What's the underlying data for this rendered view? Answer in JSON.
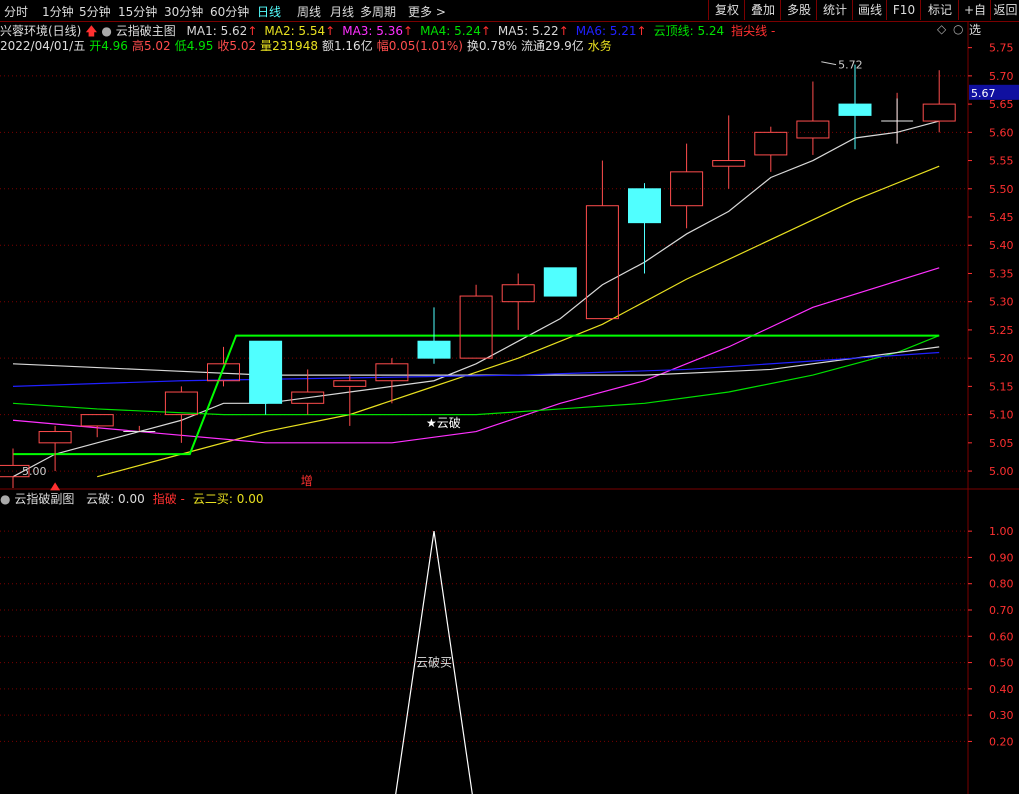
{
  "colors": {
    "up": "#ff4d4d",
    "down": "#50ffff",
    "ma1": "#d8d8d8",
    "ma2": "#e8e020",
    "ma3": "#ff30ff",
    "ma4": "#00e000",
    "ma5": "#d8d8d8",
    "ma6": "#2020ff",
    "cloud": "#00ff00",
    "grid": "#7a0000",
    "axis": "#ff3030"
  },
  "toolbar": {
    "periods": [
      "分时",
      "1分钟",
      "5分钟",
      "15分钟",
      "30分钟",
      "60分钟",
      "日线",
      "周线",
      "月线",
      "多周期",
      "更多 >"
    ],
    "active_index": 6,
    "buttons": [
      "复权",
      "叠加",
      "多股",
      "统计",
      "画线",
      "F10",
      "标记",
      "+自选",
      "返回"
    ]
  },
  "header": {
    "stock": "兴蓉环境(日线)",
    "indicator": "云指破主图",
    "ma": [
      {
        "label": "MA1: 5.62",
        "color": "#d8d8d8",
        "arrow": "↑"
      },
      {
        "label": "MA2: 5.54",
        "color": "#e8e020",
        "arrow": "↑"
      },
      {
        "label": "MA3: 5.36",
        "color": "#ff30ff",
        "arrow": "↑"
      },
      {
        "label": "MA4: 5.24",
        "color": "#00e000",
        "arrow": "↑"
      },
      {
        "label": "MA5: 5.22",
        "color": "#d8d8d8",
        "arrow": "↑"
      },
      {
        "label": "MA6: 5.21",
        "color": "#2020ff",
        "arrow": "↑"
      },
      {
        "label": "云顶线: 5.24",
        "color": "#00e000",
        "arrow": ""
      },
      {
        "label": "指尖线 -",
        "color": "#ff3030",
        "arrow": ""
      }
    ],
    "info": [
      {
        "label": "2022/04/01/五",
        "color": "#ddd"
      },
      {
        "label": "开4.96",
        "color": "#00e000"
      },
      {
        "label": "高5.02",
        "color": "#ff4d4d"
      },
      {
        "label": "低4.95",
        "color": "#00e000"
      },
      {
        "label": "收5.02",
        "color": "#ff4d4d"
      },
      {
        "label": "量231948",
        "color": "#e8e020"
      },
      {
        "label": "额1.16亿",
        "color": "#ddd"
      },
      {
        "label": "幅0.05(1.01%)",
        "color": "#ff4d4d"
      },
      {
        "label": "换0.78%",
        "color": "#ddd"
      },
      {
        "label": "流通29.9亿",
        "color": "#ddd"
      },
      {
        "label": "水务",
        "color": "#e8e020"
      }
    ]
  },
  "sub_header": {
    "name": "云指破副图",
    "items": [
      {
        "label": "云破: 0.00",
        "color": "#ddd"
      },
      {
        "label": "指破 -",
        "color": "#ff3030"
      },
      {
        "label": "云二买: 0.00",
        "color": "#e8e020"
      }
    ]
  },
  "annotations": {
    "max": "5.72",
    "min": "5.00",
    "cloud_break": "★云破",
    "zeng": "增",
    "sub_label": "云破买",
    "current_price": "5.67"
  },
  "chart_data": [
    {
      "type": "candlestick",
      "title": "云指破主图",
      "ylim": [
        4.97,
        5.76
      ],
      "yticks": [
        5.0,
        5.05,
        5.1,
        5.15,
        5.2,
        5.25,
        5.3,
        5.35,
        5.4,
        5.45,
        5.5,
        5.55,
        5.6,
        5.65,
        5.7,
        5.75
      ],
      "candles": [
        {
          "o": 4.99,
          "h": 5.04,
          "l": 4.97,
          "c": 5.01
        },
        {
          "o": 5.05,
          "h": 5.08,
          "l": 5.0,
          "c": 5.07
        },
        {
          "o": 5.08,
          "h": 5.1,
          "l": 5.06,
          "c": 5.1
        },
        {
          "o": 5.07,
          "h": 5.08,
          "l": 5.07,
          "c": 5.07
        },
        {
          "o": 5.1,
          "h": 5.15,
          "l": 5.05,
          "c": 5.14
        },
        {
          "o": 5.16,
          "h": 5.22,
          "l": 5.15,
          "c": 5.19
        },
        {
          "o": 5.23,
          "h": 5.23,
          "l": 5.1,
          "c": 5.12
        },
        {
          "o": 5.12,
          "h": 5.18,
          "l": 5.1,
          "c": 5.14
        },
        {
          "o": 5.15,
          "h": 5.17,
          "l": 5.08,
          "c": 5.16
        },
        {
          "o": 5.16,
          "h": 5.2,
          "l": 5.12,
          "c": 5.19
        },
        {
          "o": 5.23,
          "h": 5.29,
          "l": 5.19,
          "c": 5.2
        },
        {
          "o": 5.2,
          "h": 5.33,
          "l": 5.2,
          "c": 5.31
        },
        {
          "o": 5.3,
          "h": 5.35,
          "l": 5.25,
          "c": 5.33
        },
        {
          "o": 5.36,
          "h": 5.36,
          "l": 5.31,
          "c": 5.31
        },
        {
          "o": 5.27,
          "h": 5.55,
          "l": 5.27,
          "c": 5.47
        },
        {
          "o": 5.5,
          "h": 5.51,
          "l": 5.35,
          "c": 5.44
        },
        {
          "o": 5.47,
          "h": 5.58,
          "l": 5.43,
          "c": 5.53
        },
        {
          "o": 5.54,
          "h": 5.63,
          "l": 5.5,
          "c": 5.55
        },
        {
          "o": 5.56,
          "h": 5.61,
          "l": 5.53,
          "c": 5.6
        },
        {
          "o": 5.59,
          "h": 5.69,
          "l": 5.56,
          "c": 5.62
        },
        {
          "o": 5.65,
          "h": 5.72,
          "l": 5.57,
          "c": 5.63
        },
        {
          "o": 5.62,
          "h": 5.67,
          "l": 5.58,
          "c": 5.62
        },
        {
          "o": 5.62,
          "h": 5.71,
          "l": 5.6,
          "c": 5.65
        }
      ],
      "series": [
        {
          "name": "MA1",
          "color": "#d8d8d8",
          "x": [
            0,
            1,
            2,
            3,
            4,
            5,
            6,
            7,
            8,
            9,
            10,
            11,
            12,
            13,
            14,
            15,
            16,
            17,
            18,
            19,
            20,
            21,
            22
          ],
          "values": [
            4.99,
            5.03,
            5.05,
            5.07,
            5.09,
            5.12,
            5.12,
            5.13,
            5.14,
            5.15,
            5.16,
            5.19,
            5.23,
            5.27,
            5.33,
            5.37,
            5.42,
            5.46,
            5.52,
            5.55,
            5.59,
            5.6,
            5.62
          ]
        },
        {
          "name": "MA2",
          "color": "#e8e020",
          "x": [
            2,
            4,
            6,
            8,
            10,
            12,
            14,
            16,
            18,
            20,
            22
          ],
          "values": [
            4.99,
            5.03,
            5.07,
            5.1,
            5.15,
            5.2,
            5.26,
            5.34,
            5.41,
            5.48,
            5.54
          ]
        },
        {
          "name": "MA3",
          "color": "#ff30ff",
          "x": [
            0,
            3,
            6,
            9,
            11,
            13,
            15,
            17,
            19,
            22
          ],
          "values": [
            5.09,
            5.07,
            5.05,
            5.05,
            5.07,
            5.12,
            5.16,
            5.22,
            5.29,
            5.36
          ]
        },
        {
          "name": "MA4",
          "color": "#00e000",
          "x": [
            0,
            2,
            5,
            8,
            11,
            13,
            15,
            17,
            19,
            21,
            22
          ],
          "values": [
            5.12,
            5.11,
            5.1,
            5.1,
            5.1,
            5.11,
            5.12,
            5.14,
            5.17,
            5.21,
            5.24
          ]
        },
        {
          "name": "MA5",
          "color": "#d8d8d8",
          "x": [
            0,
            3,
            6,
            9,
            12,
            15,
            18,
            20,
            22
          ],
          "values": [
            5.19,
            5.18,
            5.17,
            5.17,
            5.17,
            5.17,
            5.18,
            5.2,
            5.22
          ]
        },
        {
          "name": "MA6",
          "color": "#2020ff",
          "x": [
            0,
            4,
            8,
            12,
            16,
            19,
            22
          ],
          "values": [
            5.15,
            5.16,
            5.165,
            5.17,
            5.18,
            5.195,
            5.21
          ]
        },
        {
          "name": "云顶线",
          "color": "#00ff00",
          "x": [
            0,
            4.2,
            5.3,
            22
          ],
          "values": [
            5.03,
            5.03,
            5.24,
            5.24
          ]
        }
      ]
    },
    {
      "type": "line",
      "title": "云指破副图",
      "ylim": [
        0,
        1.05
      ],
      "yticks": [
        0.2,
        0.3,
        0.4,
        0.5,
        0.6,
        0.7,
        0.8,
        0.9,
        1.0
      ],
      "series": [
        {
          "name": "云破",
          "color": "#ffffff",
          "x": [
            9,
            10,
            11
          ],
          "values": [
            -0.1,
            1.0,
            -0.1
          ]
        }
      ]
    }
  ]
}
